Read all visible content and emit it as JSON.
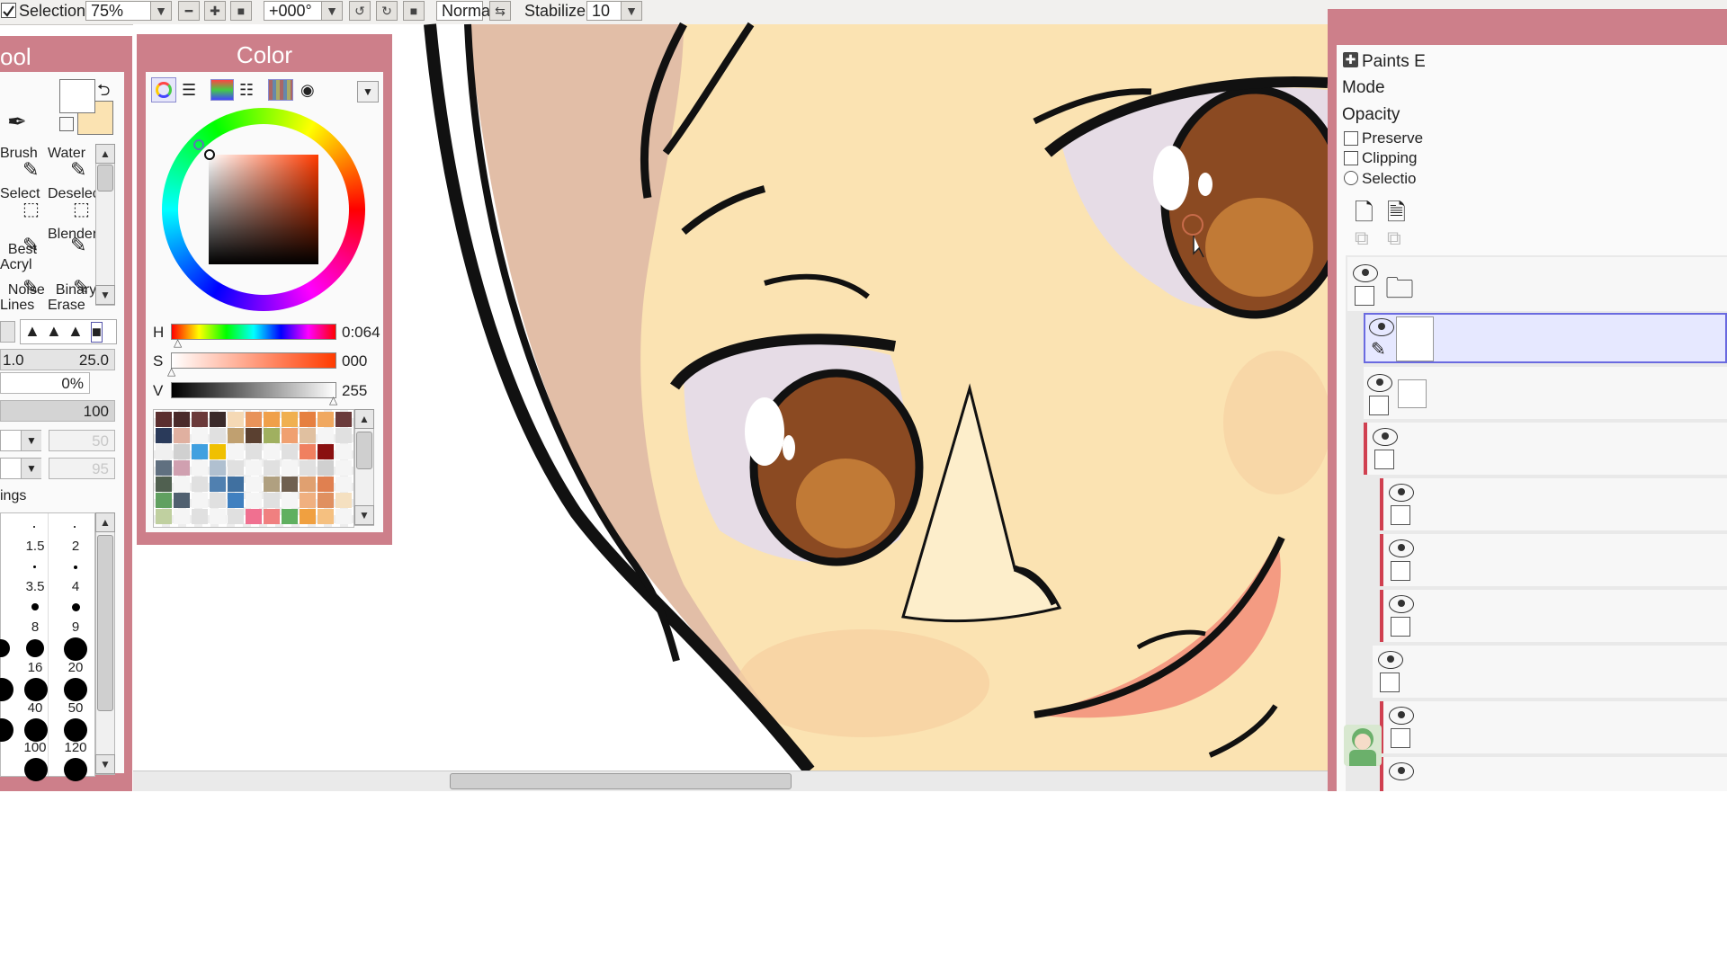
{
  "toolbar": {
    "selection_label": "Selection",
    "zoom": "75%",
    "rotation": "+000°",
    "blend_mode": "Normal",
    "stabilizer_label": "Stabilizer",
    "stabilizer_value": "10"
  },
  "tool_panel": {
    "title": "ool",
    "tools": [
      {
        "label": "Brush"
      },
      {
        "label": "Water"
      },
      {
        "label": "Select"
      },
      {
        "label": "Deselect"
      },
      {
        "label": "Best\nAcryl"
      },
      {
        "label": "Blender"
      },
      {
        "label": "Noise\nLines"
      },
      {
        "label": "Binary\nErase"
      }
    ],
    "size_min": "1.0",
    "size_max": "25.0",
    "min_size_pct": "0%",
    "density": "100",
    "field_a": "50",
    "field_b": "95",
    "settings_label": "ings",
    "brush_sizes": [
      "1.5",
      "2",
      "3.5",
      "4",
      "8",
      "9",
      "16",
      "20",
      "40",
      "50",
      "100",
      "120"
    ]
  },
  "color_panel": {
    "title": "Color",
    "h_label": "H",
    "h_value": "0:064",
    "s_label": "S",
    "s_value": "000",
    "v_label": "V",
    "v_value": "255",
    "swatches": [
      "#5a2e2e",
      "#4a2a2a",
      "#6b3a3a",
      "#3a2a2a",
      "#f5d9b5",
      "#e8935a",
      "#f0a04a",
      "#f0b050",
      "#e68040",
      "#f0a860",
      "#6a3a3a",
      "#2a3a5a",
      "#e0b0a0",
      "#f5f5f5",
      "#e0e0e0",
      "#c0a070",
      "#5a4030",
      "#a0b060",
      "#f0a070",
      "#e0c0a0",
      "#f5f5f5",
      "#e0e0e0",
      "#f0f0f0",
      "#d0d0d0",
      "#40a0e0",
      "#f0c000",
      "#f5f5f5",
      "#e0e0e0",
      "#f5f5f5",
      "#e0e0e0",
      "#f08060",
      "#8a1010",
      "#f5f5f5",
      "#607080",
      "#d0a0b0",
      "#f5f5f5",
      "#b0c0d0",
      "#e0e0e0",
      "#f5f5f5",
      "#e0e0e0",
      "#f5f5f5",
      "#e0e0e0",
      "#d0d0d0",
      "#f5f5f5",
      "#506050",
      "#f5f5f5",
      "#e0e0e0",
      "#5080b0",
      "#4070a0",
      "#f5f5f5",
      "#b0a080",
      "#706050",
      "#e0a070",
      "#e08050",
      "#f5f5f5",
      "#60a060",
      "#506070",
      "#f5f5f5",
      "#e0e0e0",
      "#4080c0",
      "#f5f5f5",
      "#e0e0e0",
      "#f5f5f5",
      "#f0b080",
      "#e09060",
      "#f5e0c0",
      "#c0d0a0",
      "#f5f5f5",
      "#e0e0e0",
      "#f5f5f5",
      "#e0e0e0",
      "#f07090",
      "#f08080",
      "#60b060",
      "#f0a040",
      "#f5c080",
      "#f5f5f5"
    ]
  },
  "layer_panel": {
    "title": "Paints E",
    "mode_label": "Mode",
    "opacity_label": "Opacity",
    "preserve_label": "Preserve",
    "clipping_label": "Clipping",
    "selection_label": "Selectio"
  },
  "colors": {
    "panel_pink": "#cd7f8a",
    "skin": "#fbe3b2",
    "hair": "#e2bea7",
    "iris": "#8b4a22",
    "mouth": "#f49b82"
  }
}
